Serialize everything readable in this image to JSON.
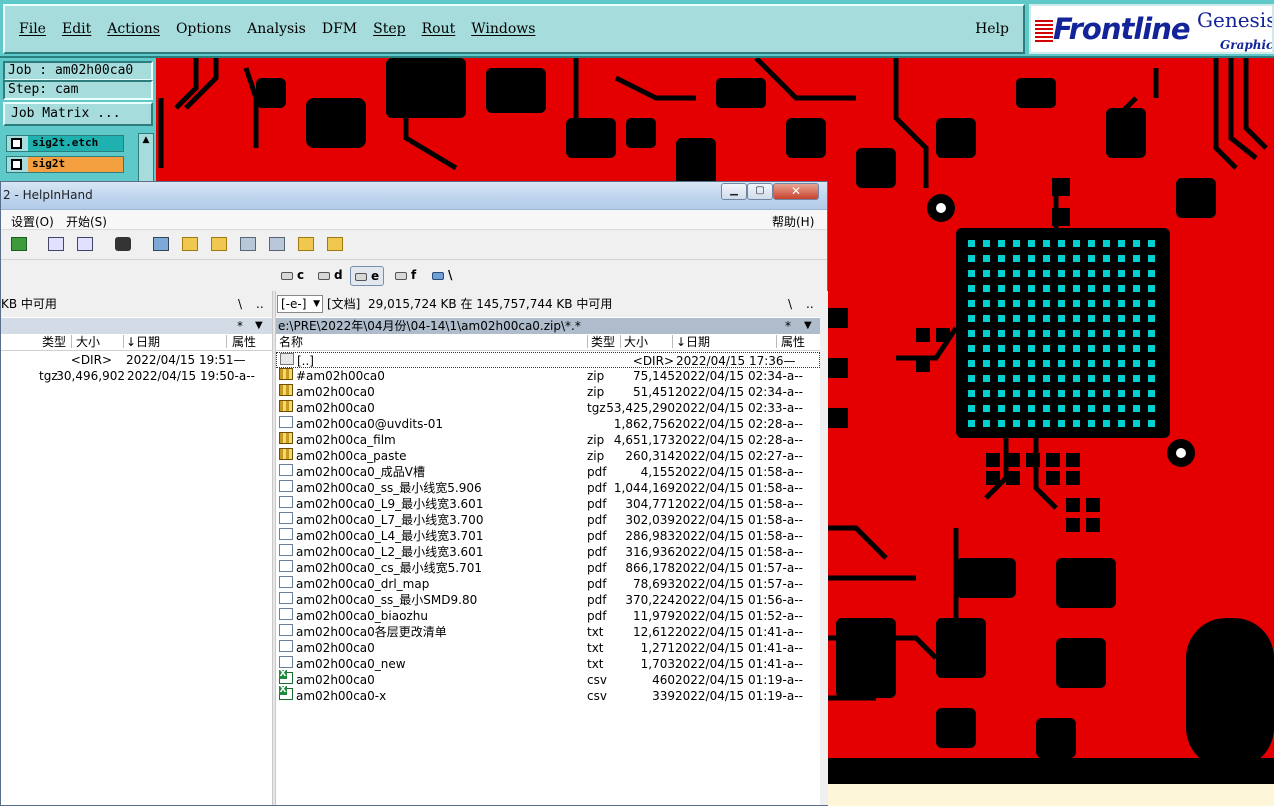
{
  "genesis": {
    "menu": [
      {
        "label": "File"
      },
      {
        "label": "Edit"
      },
      {
        "label": "Actions"
      },
      {
        "label": "Options"
      },
      {
        "label": "Analysis"
      },
      {
        "label": "DFM"
      },
      {
        "label": "Step"
      },
      {
        "label": "Rout"
      },
      {
        "label": "Windows"
      }
    ],
    "help": "Help",
    "logo": {
      "brand": "Frontline",
      "product": "Genesis",
      "tagline": "Graphic I"
    },
    "job_field": "Job : am02h00ca0",
    "step_field": "Step: cam",
    "job_matrix_label": "Job Matrix ...",
    "layers": [
      {
        "name": "sig2t.etch"
      },
      {
        "name": "sig2t"
      }
    ]
  },
  "explorer": {
    "title": "2 - HelpInHand",
    "menu": {
      "settings": "设置(O)",
      "start": "开始(S)",
      "help": "帮助(H)"
    },
    "drives": [
      {
        "label": "c"
      },
      {
        "label": "d"
      },
      {
        "label": "e"
      },
      {
        "label": "f"
      },
      {
        "label": "\\"
      }
    ],
    "left": {
      "info": "KB 中可用",
      "info_root": "\\",
      "info_up": "..",
      "filter": "*",
      "columns": {
        "type": "类型",
        "size": "大小",
        "date": "↓日期",
        "attr": "属性"
      },
      "rows": [
        {
          "ext": "",
          "size": "<DIR>",
          "date": "2022/04/15 19:51—"
        },
        {
          "ext": "tgz",
          "size": "30,496,902",
          "date": "2022/04/15 19:50-a--"
        }
      ]
    },
    "right": {
      "drive_select": "[-e-]",
      "volume": "[文档]",
      "info": "29,015,724 KB 在 145,757,744 KB 中可用",
      "info_root": "\\",
      "info_up": "..",
      "path": "e:\\PRE\\2022年\\04月份\\04-14\\1\\am02h00ca0.zip\\*.*",
      "filter": "*",
      "columns": {
        "name": "名称",
        "type": "类型",
        "size": "大小",
        "date": "↓日期",
        "attr": "属性"
      },
      "rows": [
        {
          "name": "[..]",
          "ext": "",
          "size": "<DIR>",
          "date": "2022/04/15 17:36—",
          "icon": "up"
        },
        {
          "name": "#am02h00ca0",
          "ext": "zip",
          "size": "75,145",
          "date": "2022/04/15 02:34-a--",
          "icon": "zip"
        },
        {
          "name": "am02h00ca0",
          "ext": "zip",
          "size": "51,451",
          "date": "2022/04/15 02:34-a--",
          "icon": "zip"
        },
        {
          "name": "am02h00ca0",
          "ext": "tgz",
          "size": "53,425,290",
          "date": "2022/04/15 02:33-a--",
          "icon": "zip"
        },
        {
          "name": "am02h00ca0@uvdits-01",
          "ext": "",
          "size": "1,862,756",
          "date": "2022/04/15 02:28-a--",
          "icon": "file"
        },
        {
          "name": "am02h00ca_film",
          "ext": "zip",
          "size": "4,651,173",
          "date": "2022/04/15 02:28-a--",
          "icon": "zip"
        },
        {
          "name": "am02h00ca_paste",
          "ext": "zip",
          "size": "260,314",
          "date": "2022/04/15 02:27-a--",
          "icon": "zip"
        },
        {
          "name": "am02h00ca0_成品V槽",
          "ext": "pdf",
          "size": "4,155",
          "date": "2022/04/15 01:58-a--",
          "icon": "pdf"
        },
        {
          "name": "am02h00ca0_ss_最小线宽5.906",
          "ext": "pdf",
          "size": "1,044,169",
          "date": "2022/04/15 01:58-a--",
          "icon": "pdf"
        },
        {
          "name": "am02h00ca0_L9_最小线宽3.601",
          "ext": "pdf",
          "size": "304,771",
          "date": "2022/04/15 01:58-a--",
          "icon": "pdf"
        },
        {
          "name": "am02h00ca0_L7_最小线宽3.700",
          "ext": "pdf",
          "size": "302,039",
          "date": "2022/04/15 01:58-a--",
          "icon": "pdf"
        },
        {
          "name": "am02h00ca0_L4_最小线宽3.701",
          "ext": "pdf",
          "size": "286,983",
          "date": "2022/04/15 01:58-a--",
          "icon": "pdf"
        },
        {
          "name": "am02h00ca0_L2_最小线宽3.601",
          "ext": "pdf",
          "size": "316,936",
          "date": "2022/04/15 01:58-a--",
          "icon": "pdf"
        },
        {
          "name": "am02h00ca0_cs_最小线宽5.701",
          "ext": "pdf",
          "size": "866,178",
          "date": "2022/04/15 01:57-a--",
          "icon": "pdf"
        },
        {
          "name": "am02h00ca0_drl_map",
          "ext": "pdf",
          "size": "78,693",
          "date": "2022/04/15 01:57-a--",
          "icon": "pdf"
        },
        {
          "name": "am02h00ca0_ss_最小SMD9.80",
          "ext": "pdf",
          "size": "370,224",
          "date": "2022/04/15 01:56-a--",
          "icon": "pdf"
        },
        {
          "name": "am02h00ca0_biaozhu",
          "ext": "pdf",
          "size": "11,979",
          "date": "2022/04/15 01:52-a--",
          "icon": "pdf"
        },
        {
          "name": "am02h00ca0各层更改清单",
          "ext": "txt",
          "size": "12,612",
          "date": "2022/04/15 01:41-a--",
          "icon": "txt"
        },
        {
          "name": "am02h00ca0",
          "ext": "txt",
          "size": "1,271",
          "date": "2022/04/15 01:41-a--",
          "icon": "txt"
        },
        {
          "name": "am02h00ca0_new",
          "ext": "txt",
          "size": "1,703",
          "date": "2022/04/15 01:41-a--",
          "icon": "txt"
        },
        {
          "name": "am02h00ca0",
          "ext": "csv",
          "size": "460",
          "date": "2022/04/15 01:19-a--",
          "icon": "csv"
        },
        {
          "name": "am02h00ca0-x",
          "ext": "csv",
          "size": "339",
          "date": "2022/04/15 01:19-a--",
          "icon": "csv"
        }
      ]
    }
  },
  "colors": {
    "cam_background": "#e40000",
    "cam_copper": "#000000",
    "cam_pads": "#00d0d0",
    "genesis_panel": "#a6dcdc"
  }
}
